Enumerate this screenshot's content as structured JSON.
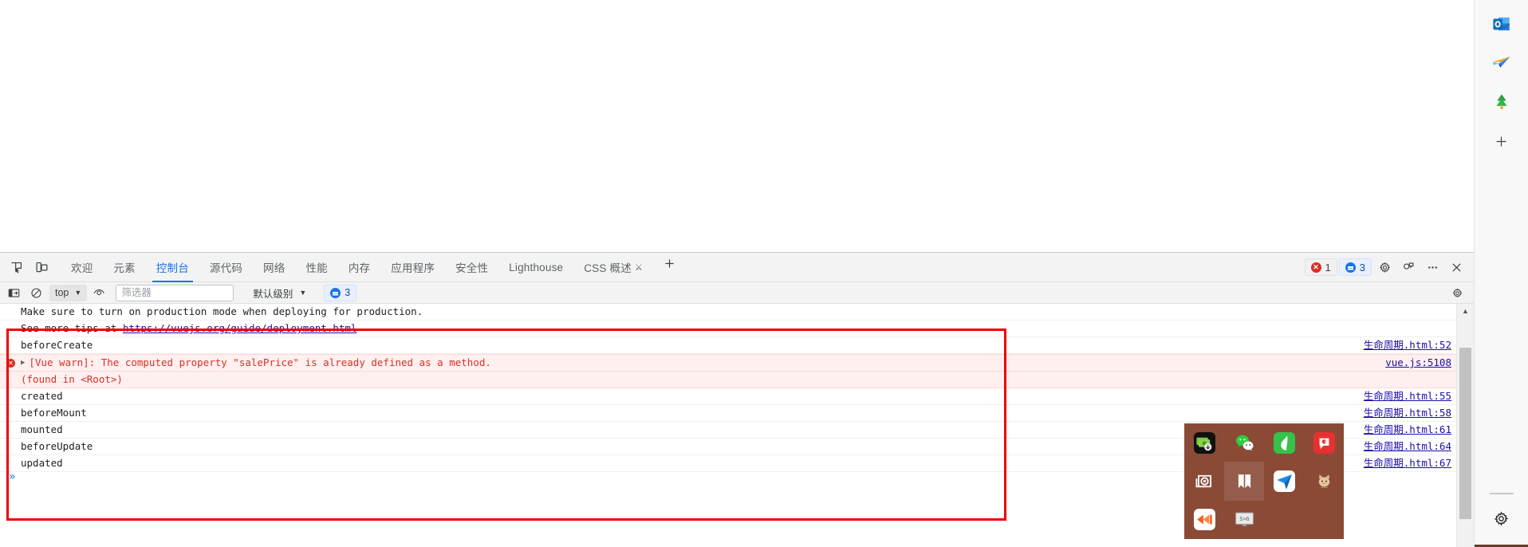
{
  "page": {
    "viewport_blank": true
  },
  "devtools": {
    "tabstrip": {
      "inspect_icon": "inspect-element-icon",
      "device_icon": "device-toolbar-icon",
      "tabs": [
        {
          "label": "欢迎",
          "name": "welcome",
          "active": false
        },
        {
          "label": "元素",
          "name": "elements",
          "active": false
        },
        {
          "label": "控制台",
          "name": "console",
          "active": true
        },
        {
          "label": "源代码",
          "name": "sources",
          "active": false
        },
        {
          "label": "网络",
          "name": "network",
          "active": false
        },
        {
          "label": "性能",
          "name": "performance",
          "active": false
        },
        {
          "label": "内存",
          "name": "memory",
          "active": false
        },
        {
          "label": "应用程序",
          "name": "application",
          "active": false
        },
        {
          "label": "安全性",
          "name": "security",
          "active": false
        },
        {
          "label": "Lighthouse",
          "name": "lighthouse",
          "active": false
        },
        {
          "label": "CSS 概述",
          "name": "css-overview",
          "active": false,
          "experimental": true
        }
      ],
      "add_tab_label": "+",
      "error_count": "1",
      "message_count": "3",
      "settings_icon": "gear-icon",
      "dock_icon": "dock-position-icon",
      "more_icon": "more-options-icon",
      "close_icon": "close-icon",
      "accent_color": "#1a73e8",
      "error_color": "#d93025"
    },
    "console_toolbar": {
      "sidebar_toggle_icon": "console-sidebar-icon",
      "clear_icon": "clear-console-icon",
      "context_value": "top",
      "eye_icon": "live-expression-icon",
      "filter_placeholder": "筛选器",
      "filter_value": "",
      "level_label": "默认级别",
      "message_chip_count": "3",
      "settings_icon": "gear-icon"
    },
    "logs": [
      {
        "text": "Make sure to turn on production mode when deploying for production.",
        "type": "plain",
        "source": ""
      },
      {
        "text": "See more tips at ",
        "link": "https://vuejs.org/guide/deployment.html",
        "type": "plain-link",
        "source": ""
      },
      {
        "text": "beforeCreate",
        "type": "plain",
        "source": "生命周期.html:52"
      },
      {
        "text": "[Vue warn]: The computed property \"salePrice\" is already defined as a method.",
        "type": "warn",
        "expandable": true,
        "source": "vue.js:5108"
      },
      {
        "text": "(found in <Root>)",
        "type": "warn2",
        "source": ""
      },
      {
        "text": "created",
        "type": "plain",
        "source": "生命周期.html:55"
      },
      {
        "text": "beforeMount",
        "type": "plain",
        "source": "生命周期.html:58"
      },
      {
        "text": "mounted",
        "type": "plain",
        "source": "生命周期.html:61"
      },
      {
        "text": "beforeUpdate",
        "type": "plain",
        "source": "生命周期.html:64"
      },
      {
        "text": "updated",
        "type": "plain",
        "source": "生命周期.html:67"
      }
    ],
    "prompt": {
      "symbol": "»",
      "value": ""
    },
    "annotation": {
      "color": "#ee0000",
      "shape": "rectangle"
    }
  },
  "dock": {
    "background_color": "#8a4a36",
    "apps": [
      {
        "name": "money-download-app",
        "label": ""
      },
      {
        "name": "wechat-app",
        "label": ""
      },
      {
        "name": "green-leaf-app",
        "label": ""
      },
      {
        "name": "red-chat-app",
        "label": ""
      },
      {
        "name": "camera-app",
        "label": ""
      },
      {
        "name": "bookmark-app",
        "label": "",
        "selected": true
      },
      {
        "name": "blue-arrow-app",
        "label": ""
      },
      {
        "name": "cat-app",
        "label": ""
      },
      {
        "name": "media-player-app",
        "label": ""
      },
      {
        "name": "svg-converter-app",
        "label": "SVG"
      }
    ]
  },
  "edge_sidebar": {
    "items": [
      {
        "name": "outlook-icon",
        "label": ""
      },
      {
        "name": "paper-plane-icon",
        "label": ""
      },
      {
        "name": "tree-icon",
        "label": ""
      },
      {
        "name": "add-sidebar-icon",
        "label": "+"
      }
    ],
    "settings_icon": "gear-icon"
  }
}
